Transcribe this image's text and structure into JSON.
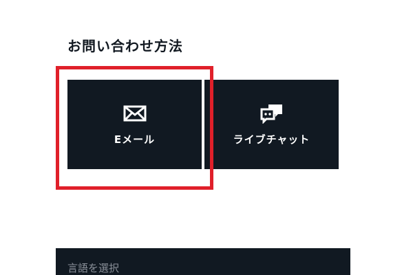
{
  "contact": {
    "title": "お問い合わせ方法",
    "options": [
      {
        "label": "Eメール",
        "icon": "envelope-icon",
        "highlighted": true
      },
      {
        "label": "ライブチャット",
        "icon": "chat-bubbles-icon",
        "highlighted": false
      }
    ]
  },
  "language": {
    "label": "言語を選択"
  },
  "colors": {
    "tile_background": "#111922",
    "highlight_border": "#e0202a",
    "text_dark": "#111820"
  }
}
